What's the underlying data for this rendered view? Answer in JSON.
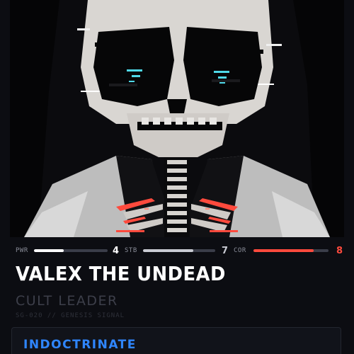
{
  "card": {
    "name": "VALEX THE UNDEAD",
    "role": "CULT LEADER",
    "set_code": "SG-020 // GENESIS SIGNAL",
    "ability_name": "INDOCTRINATE",
    "art_subject": "skull-figure-art"
  },
  "stats": [
    {
      "label": "PWR",
      "value": "4",
      "level": 0.4,
      "color": "#ffffff"
    },
    {
      "label": "STB",
      "value": "7",
      "level": 0.7,
      "color": "#c9cbd3"
    },
    {
      "label": "COR",
      "value": "8",
      "level": 0.8,
      "color": "#ff4a3d"
    }
  ],
  "colors": {
    "accent_blue": "#2f86ff",
    "corruption_red": "#ff4a3d",
    "background": "#0c0d12"
  }
}
